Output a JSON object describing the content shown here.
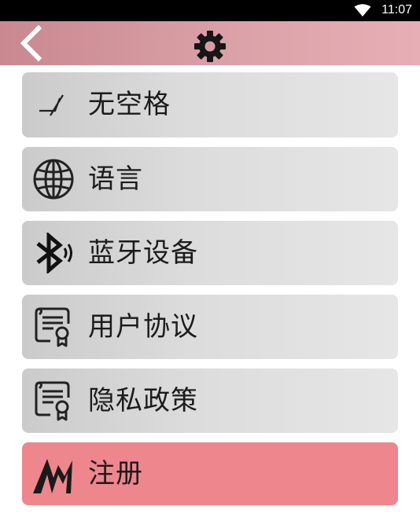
{
  "status_bar": {
    "time": "11:07"
  },
  "header": {
    "back_icon": "chevron-left-icon",
    "title_icon": "gear-icon"
  },
  "menu": {
    "items": [
      {
        "label": "无空格",
        "icon": "no-space-icon"
      },
      {
        "label": "语言",
        "icon": "globe-icon"
      },
      {
        "label": "蓝牙设备",
        "icon": "bluetooth-icon"
      },
      {
        "label": "用户协议",
        "icon": "certificate-icon"
      },
      {
        "label": "隐私政策",
        "icon": "certificate-icon"
      },
      {
        "label": "注册",
        "icon": "register-logo-icon",
        "highlight_color": "#ee868d"
      }
    ]
  }
}
